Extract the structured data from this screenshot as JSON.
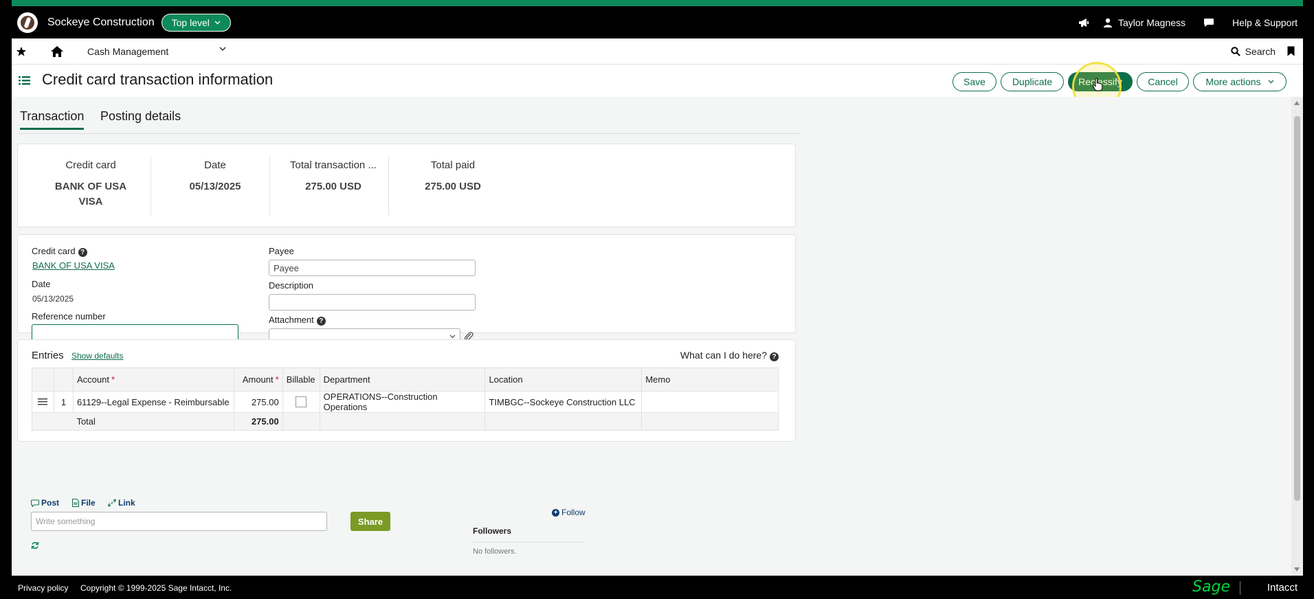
{
  "top": {
    "company": "Sockeye Construction",
    "level": "Top level",
    "user": "Taylor Magness",
    "help": "Help & Support"
  },
  "nav": {
    "module": "Cash Management",
    "search": "Search"
  },
  "page": {
    "title": "Credit card transaction information"
  },
  "actions": {
    "save": "Save",
    "duplicate": "Duplicate",
    "reclassify": "Reclassify",
    "cancel": "Cancel",
    "more": "More actions"
  },
  "tabs": [
    "Transaction",
    "Posting details"
  ],
  "summary": {
    "credit_card_label": "Credit card",
    "credit_card_value_1": "BANK OF USA",
    "credit_card_value_2": "VISA",
    "date_label": "Date",
    "date_value": "05/13/2025",
    "total_label": "Total transaction ...",
    "total_value": "275.00 USD",
    "paid_label": "Total paid",
    "paid_value": "275.00 USD"
  },
  "form": {
    "credit_card_label": "Credit card",
    "credit_card_value": "BANK OF USA VISA",
    "date_label": "Date",
    "date_value": "05/13/2025",
    "reference_label": "Reference number",
    "reference_value": "",
    "payee_label": "Payee",
    "payee_value": "Payee",
    "description_label": "Description",
    "description_value": "",
    "attachment_label": "Attachment"
  },
  "entries": {
    "title": "Entries",
    "show_defaults": "Show defaults",
    "help": "What can I do here?",
    "columns": [
      "Account",
      "Amount",
      "Billable",
      "Department",
      "Location",
      "Memo"
    ],
    "rows": [
      {
        "num": "1",
        "account": "61129--Legal Expense - Reimbursable",
        "amount": "275.00",
        "department": "OPERATIONS--Construction Operations",
        "location": "TIMBGC--Sockeye Construction LLC",
        "memo": ""
      }
    ],
    "total_label": "Total",
    "total_value": "275.00"
  },
  "social": {
    "post": "Post",
    "file": "File",
    "link": "Link",
    "placeholder": "Write something",
    "share": "Share",
    "follow": "Follow",
    "followers": "Followers",
    "no_followers": "No followers."
  },
  "footer": {
    "privacy": "Privacy policy",
    "copyright": "Copyright © 1999-2025 Sage Intacct, Inc.",
    "brand_sage": "Sage",
    "brand_intacct": "Intacct"
  },
  "colors": {
    "brand_green": "#0d6e4a",
    "accent_green": "#0d8a5a",
    "share_olive": "#7a9a26",
    "cursor_highlight": "#f3e13a"
  }
}
